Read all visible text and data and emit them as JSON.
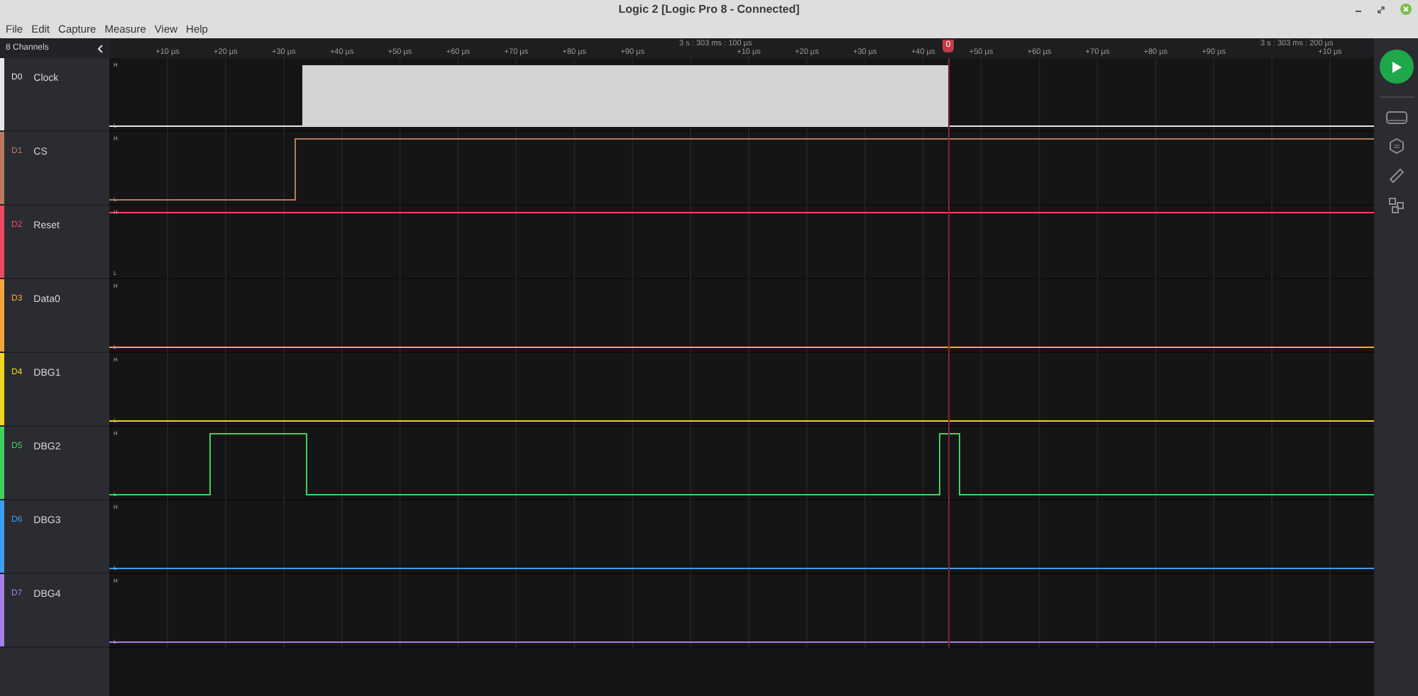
{
  "window": {
    "title": "Logic 2 [Logic Pro 8 - Connected]"
  },
  "menu": [
    "File",
    "Edit",
    "Capture",
    "Measure",
    "View",
    "Help"
  ],
  "channels_header": "8 Channels",
  "ruler": {
    "groups": [
      "3 s : 303 ms : 100 µs",
      "3 s : 303 ms : 200 µs"
    ],
    "ticks": [
      "+10 µs",
      "+20 µs",
      "+30 µs",
      "+40 µs",
      "+50 µs",
      "+60 µs",
      "+70 µs",
      "+80 µs",
      "+90 µs",
      "+10 µs",
      "+20 µs",
      "+30 µs",
      "+40 µs",
      "+50 µs",
      "+60 µs",
      "+70 µs",
      "+80 µs",
      "+90 µs",
      "+10 µs"
    ],
    "marker": "0"
  },
  "channels": [
    {
      "id": "D0",
      "name": "Clock",
      "color": "#e6e6e6",
      "high_label": "H",
      "low_label": "L"
    },
    {
      "id": "D1",
      "name": "CS",
      "color": "#b87a5c",
      "high_label": "H",
      "low_label": "L"
    },
    {
      "id": "D2",
      "name": "Reset",
      "color": "#ec4a63",
      "high_label": "H",
      "low_label": "L"
    },
    {
      "id": "D3",
      "name": "Data0",
      "color": "#f3a63f",
      "high_label": "H",
      "low_label": "L"
    },
    {
      "id": "D4",
      "name": "DBG1",
      "color": "#f1d51f",
      "high_label": "H",
      "low_label": "L"
    },
    {
      "id": "D5",
      "name": "DBG2",
      "color": "#42cf62",
      "high_label": "H",
      "low_label": "L"
    },
    {
      "id": "D6",
      "name": "DBG3",
      "color": "#3e9ef0",
      "high_label": "H",
      "low_label": "L"
    },
    {
      "id": "D7",
      "name": "DBG4",
      "color": "#a57fe6",
      "high_label": "H",
      "low_label": "L"
    }
  ]
}
